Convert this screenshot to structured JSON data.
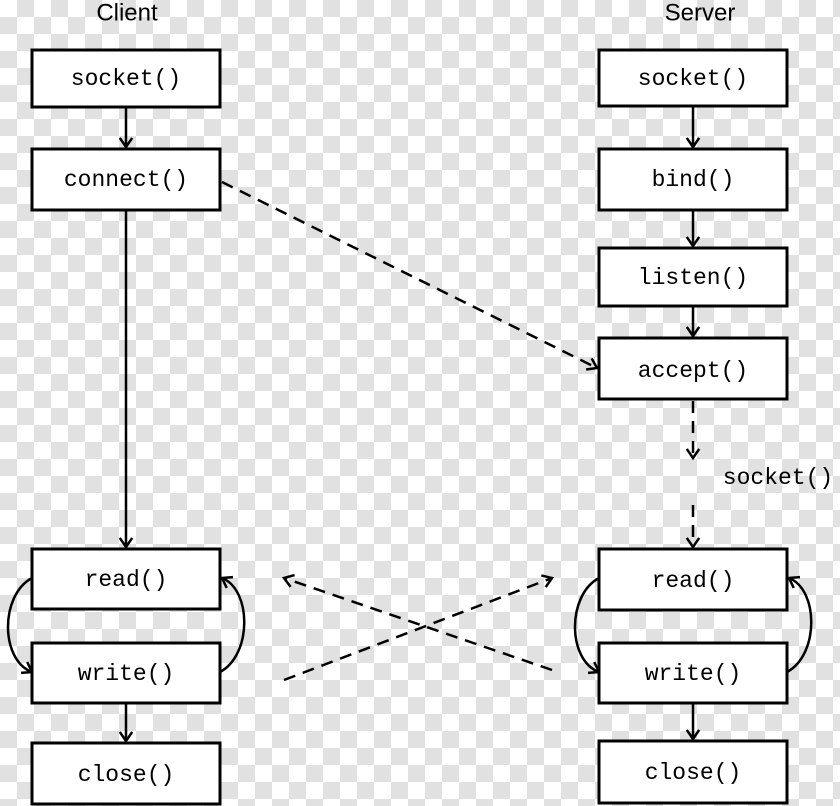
{
  "client": {
    "title": "Client",
    "steps": [
      "socket()",
      "connect()",
      "read()",
      "write()",
      "close()"
    ]
  },
  "server": {
    "title": "Server",
    "steps": [
      "socket()",
      "bind()",
      "listen()",
      "accept()",
      "read()",
      "write()",
      "close()"
    ]
  },
  "edge_label": "socket()"
}
